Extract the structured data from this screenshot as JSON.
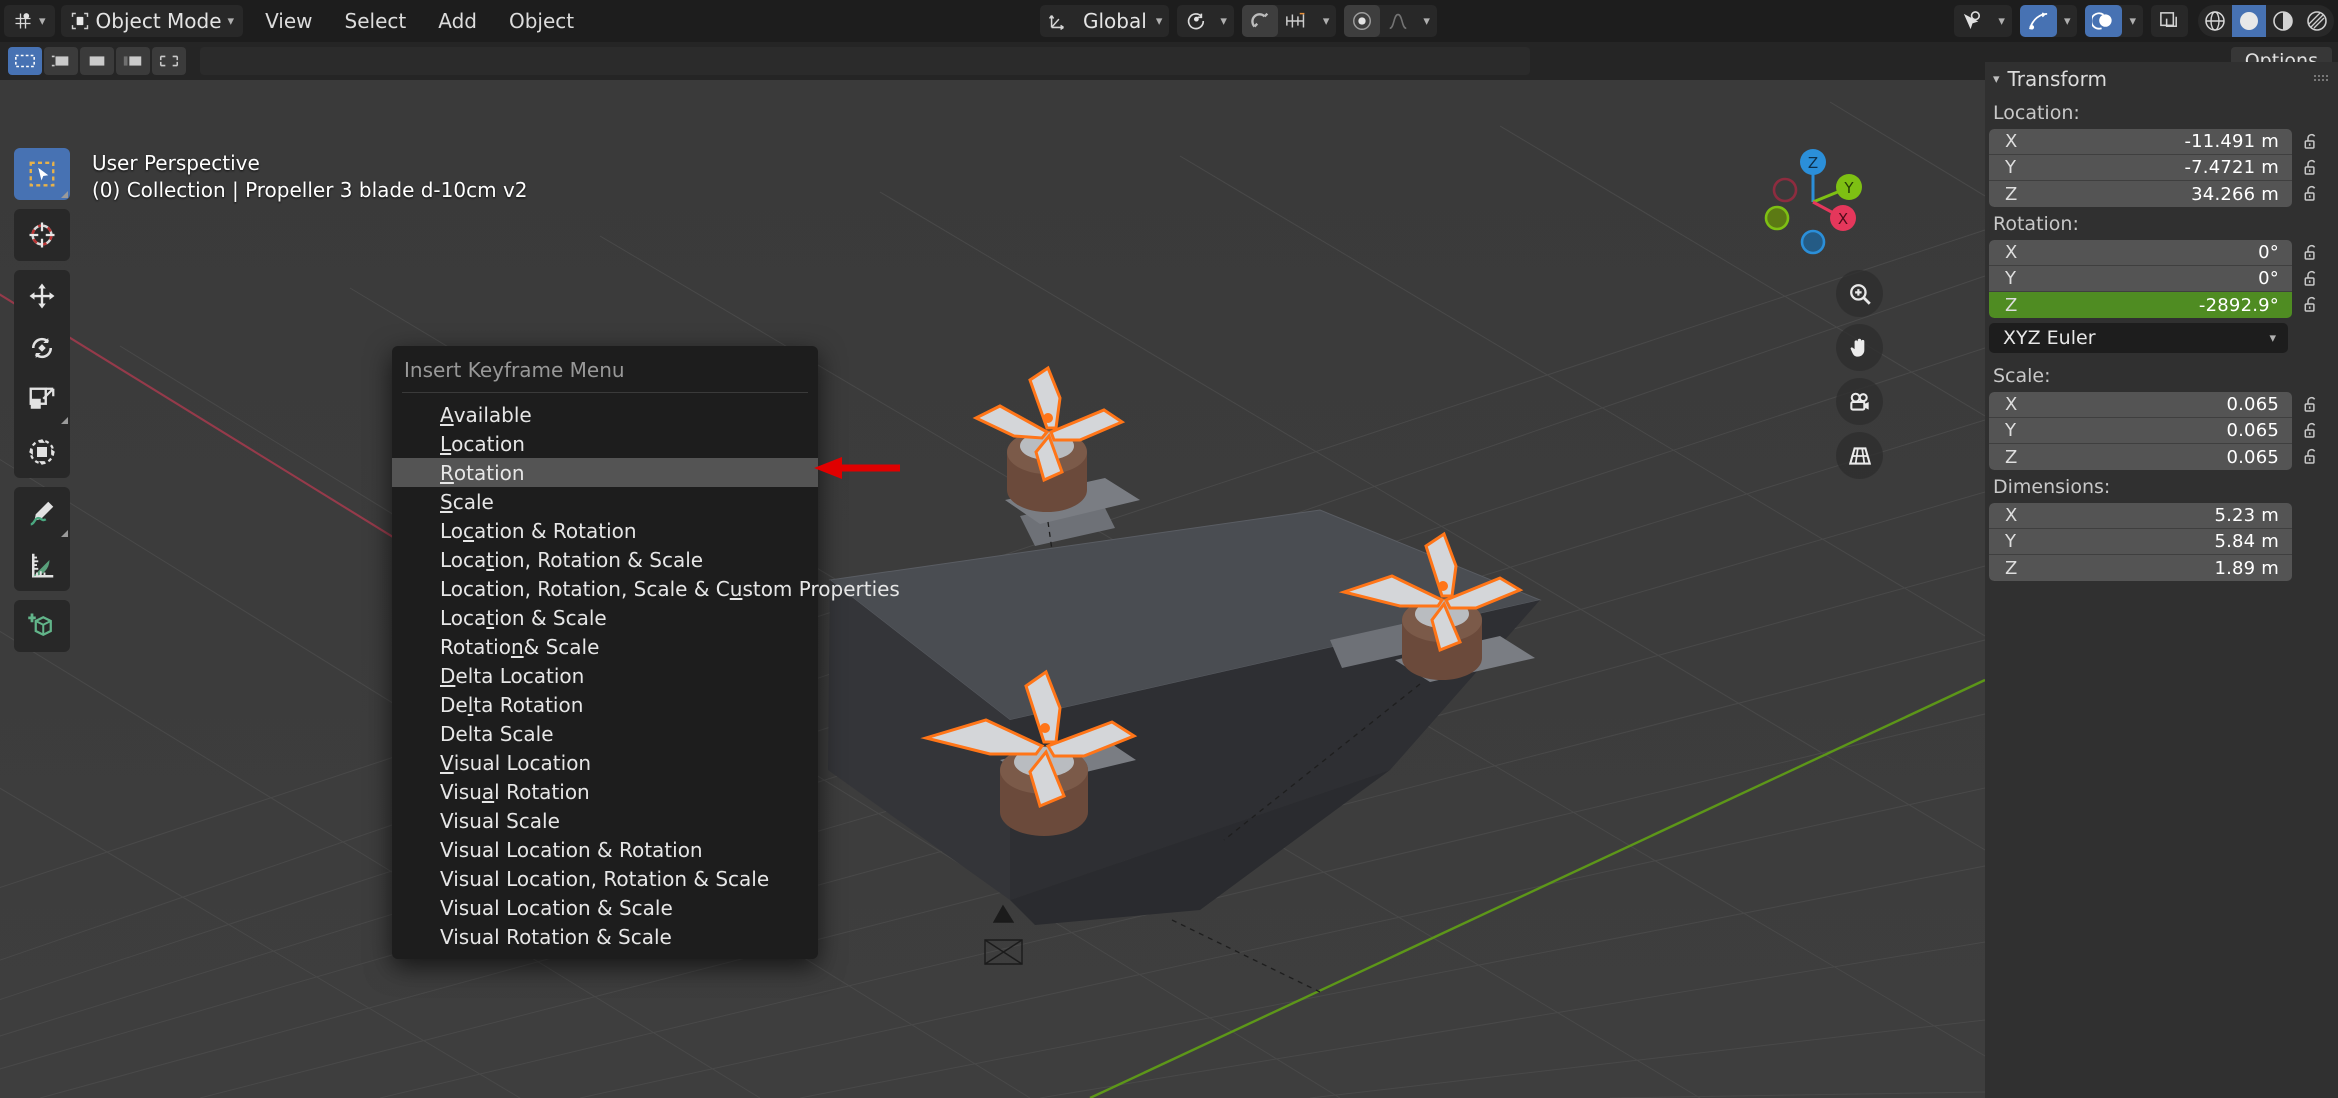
{
  "app": {
    "name": "Blender",
    "editor": "3D Viewport"
  },
  "topbar": {
    "editor_type_label": "",
    "mode_label": "Object Mode",
    "menus": [
      "View",
      "Select",
      "Add",
      "Object"
    ],
    "transform_orientation": "Global",
    "icons": [
      "editor-type-icon",
      "object-mode-icon",
      "chevron-down-icon",
      "transform-orientation-icon",
      "pivot-point-icon",
      "snap-magnet-icon",
      "snap-increment-icon",
      "proportional-editing-icon",
      "falloff-curve-icon",
      "show-gizmo-icon",
      "show-overlays-icon",
      "xray-toggle-icon",
      "shading-wireframe-icon",
      "shading-solid-icon",
      "shading-material-icon",
      "shading-rendered-icon"
    ]
  },
  "toolrow": {
    "select_modes": [
      "tweak-select",
      "box-select",
      "circle-select",
      "lasso-select",
      "select-extend"
    ],
    "options_label": "Options"
  },
  "viewport": {
    "perspective_label": "User Perspective",
    "scene_label": "(0) Collection | Propeller 3 blade d-10cm v2",
    "gizmo_axes": [
      {
        "name": "Z",
        "color": "#2b8fd9",
        "label": "Z"
      },
      {
        "name": "Y",
        "color": "#7ec013",
        "label": "Y"
      },
      {
        "name": "X",
        "color": "#e5375b",
        "label": "X"
      }
    ],
    "nav_buttons": [
      "zoom-icon",
      "pan-hand-icon",
      "camera-view-icon",
      "toggle-perspective-icon"
    ],
    "grid_color": "#4a4a4a",
    "background_color": "#3b3b3b",
    "axis_x_color": "#a63a4a",
    "axis_y_color": "#5a9e13"
  },
  "toolbar": {
    "tools": [
      {
        "name": "tweak-tool",
        "active": true
      },
      {
        "name": "cursor-tool",
        "active": false
      },
      {
        "name": "move-tool",
        "active": false
      },
      {
        "name": "rotate-tool",
        "active": false
      },
      {
        "name": "scale-tool",
        "active": false
      },
      {
        "name": "transform-tool",
        "active": false
      },
      {
        "name": "annotate-tool",
        "active": false
      },
      {
        "name": "measure-tool",
        "active": false
      },
      {
        "name": "add-cube-tool",
        "active": false
      }
    ]
  },
  "keyframe_menu": {
    "title": "Insert Keyframe Menu",
    "selected_index": 2,
    "items": [
      {
        "label": "Available",
        "accel": 0
      },
      {
        "label": "Location",
        "accel": 0
      },
      {
        "label": "Rotation",
        "accel": 0
      },
      {
        "label": "Scale",
        "accel": 0
      },
      {
        "label": "Location & Rotation",
        "accel": 2
      },
      {
        "label": "Location, Rotation & Scale",
        "accel": 4
      },
      {
        "label": "Location, Rotation, Scale & Custom Properties",
        "accel": 29
      },
      {
        "label": "Location & Scale",
        "accel": 4
      },
      {
        "label": "Rotation & Scale",
        "accel": 7
      },
      {
        "label": "Delta Location",
        "accel": 0
      },
      {
        "label": "Delta Rotation",
        "accel": 2
      },
      {
        "label": "Delta Scale",
        "accel": -1
      },
      {
        "label": "Visual Location",
        "accel": 0
      },
      {
        "label": "Visual Rotation",
        "accel": 4
      },
      {
        "label": "Visual Scale",
        "accel": -1
      },
      {
        "label": "Visual Location & Rotation",
        "accel": -1
      },
      {
        "label": "Visual Location, Rotation & Scale",
        "accel": -1
      },
      {
        "label": "Visual Location & Scale",
        "accel": -1
      },
      {
        "label": "Visual Rotation & Scale",
        "accel": -1
      }
    ]
  },
  "annotation": {
    "arrow_color": "#e00000",
    "points_to": "Rotation"
  },
  "npanel": {
    "panel_title": "Transform",
    "sections": {
      "location": {
        "label": "Location:",
        "rows": [
          {
            "axis": "X",
            "value": "-11.491 m"
          },
          {
            "axis": "Y",
            "value": "-7.4721 m"
          },
          {
            "axis": "Z",
            "value": "34.266 m"
          }
        ]
      },
      "rotation": {
        "label": "Rotation:",
        "rows": [
          {
            "axis": "X",
            "value": "0°",
            "highlight": false
          },
          {
            "axis": "Y",
            "value": "0°",
            "highlight": false
          },
          {
            "axis": "Z",
            "value": "-2892.9°",
            "highlight": true
          }
        ],
        "mode_value": "XYZ Euler",
        "highlight_color": "#4f8c22"
      },
      "scale": {
        "label": "Scale:",
        "rows": [
          {
            "axis": "X",
            "value": "0.065"
          },
          {
            "axis": "Y",
            "value": "0.065"
          },
          {
            "axis": "Z",
            "value": "0.065"
          }
        ]
      },
      "dimensions": {
        "label": "Dimensions:",
        "rows": [
          {
            "axis": "X",
            "value": "5.23 m"
          },
          {
            "axis": "Y",
            "value": "5.84 m"
          },
          {
            "axis": "Z",
            "value": "1.89 m"
          }
        ]
      }
    }
  }
}
